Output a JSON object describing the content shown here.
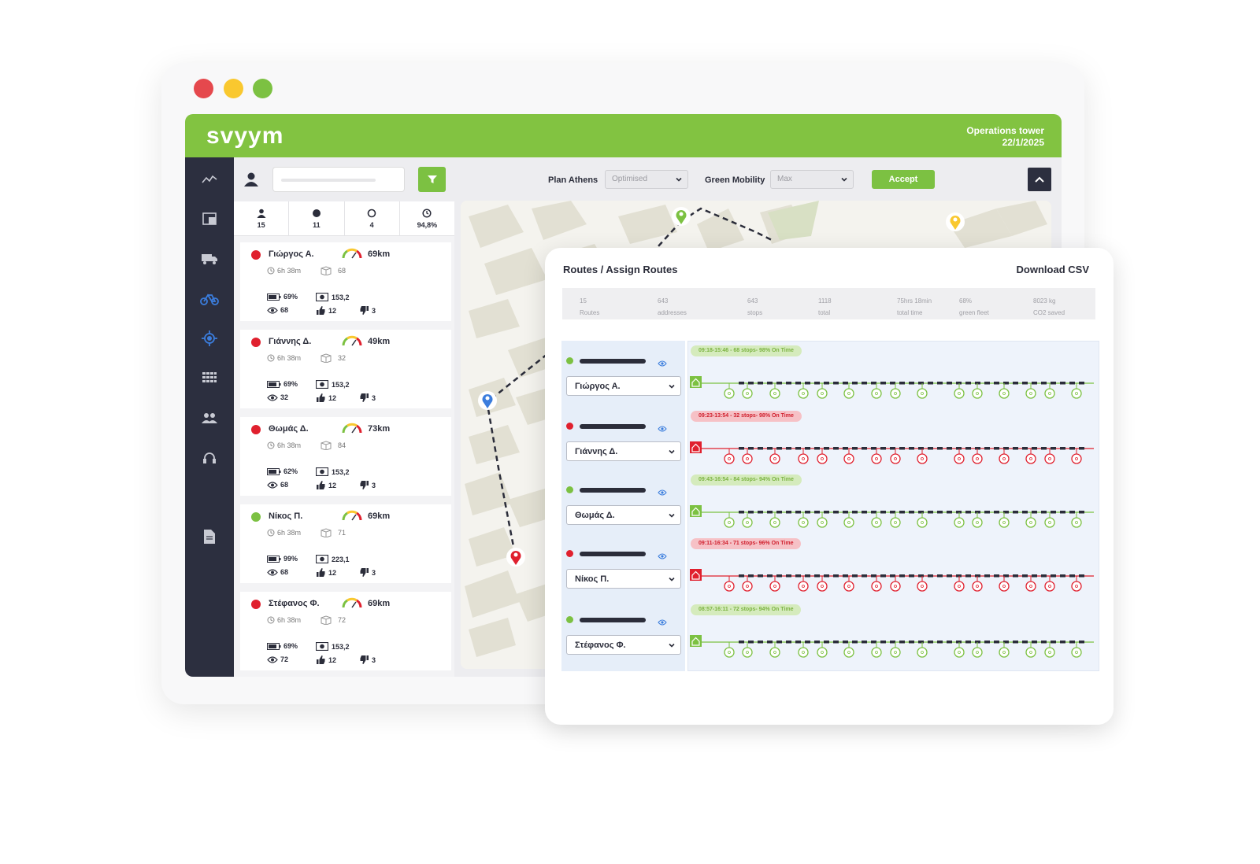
{
  "header": {
    "logo": "svyym",
    "title": "Operations tower",
    "date": "22/1/2025"
  },
  "toolbar": {
    "plan_label": "Plan Athens",
    "plan_value": "Optimised",
    "mobility_label": "Green Mobility",
    "mobility_value": "Max",
    "accept_label": "Accept"
  },
  "summary": {
    "drivers": "15",
    "active": "11",
    "idle": "4",
    "ontime": "94,8%"
  },
  "drivers": [
    {
      "name": "Γιώργος Α.",
      "status": "red",
      "km": "69km",
      "time": "6h 38m",
      "packages": "68",
      "battery": "69%",
      "distance": "153,2",
      "views": "68",
      "likes": "12",
      "dislikes": "3"
    },
    {
      "name": "Γιάννης Δ.",
      "status": "red",
      "km": "49km",
      "time": "6h 38m",
      "packages": "32",
      "battery": "69%",
      "distance": "153,2",
      "views": "32",
      "likes": "12",
      "dislikes": "3"
    },
    {
      "name": "Θωμάς Δ.",
      "status": "red",
      "km": "73km",
      "time": "6h 38m",
      "packages": "84",
      "battery": "62%",
      "distance": "153,2",
      "views": "68",
      "likes": "12",
      "dislikes": "3"
    },
    {
      "name": "Νίκος Π.",
      "status": "green",
      "km": "69km",
      "time": "6h 38m",
      "packages": "71",
      "battery": "99%",
      "distance": "223,1",
      "views": "68",
      "likes": "12",
      "dislikes": "3"
    },
    {
      "name": "Στέφανος Φ.",
      "status": "red",
      "km": "69km",
      "time": "6h 38m",
      "packages": "72",
      "battery": "69%",
      "distance": "153,2",
      "views": "72",
      "likes": "12",
      "dislikes": "3"
    }
  ],
  "routes_panel": {
    "title": "Routes / Assign Routes",
    "download": "Download CSV",
    "stats": [
      {
        "value": "15",
        "label": "Routes"
      },
      {
        "value": "643",
        "label": "addresses"
      },
      {
        "value": "643",
        "label": "stops"
      },
      {
        "value": "1118",
        "label": "total"
      },
      {
        "value": "75hrs 18min",
        "label": "total time"
      },
      {
        "value": "68%",
        "label": "green fleet"
      },
      {
        "value": "8023 kg",
        "label": "CO2 saved"
      }
    ],
    "routes": [
      {
        "driver": "Γιώργος Α.",
        "status": "green",
        "pill": "09:18-15:46 - 68 stops- 98% On Time"
      },
      {
        "driver": "Γιάννης Δ.",
        "status": "red",
        "pill": "09:23-13:54 - 32 stops- 98% On Time"
      },
      {
        "driver": "Θωμάς Δ.",
        "status": "green",
        "pill": "09:43-16:54 - 84 stops- 94% On Time"
      },
      {
        "driver": "Νίκος Π.",
        "status": "red",
        "pill": "09:11-16:34 - 71 stops- 96% On Time"
      },
      {
        "driver": "Στέφανος Φ.",
        "status": "green",
        "pill": "08:57-16:11 - 72 stops- 94% On Time"
      }
    ]
  },
  "colors": {
    "brand": "#82c341",
    "dark": "#2c2f3f",
    "red": "#e0202e",
    "green": "#7cc142",
    "blue": "#3b7ddd",
    "yellow": "#f9c82f"
  }
}
